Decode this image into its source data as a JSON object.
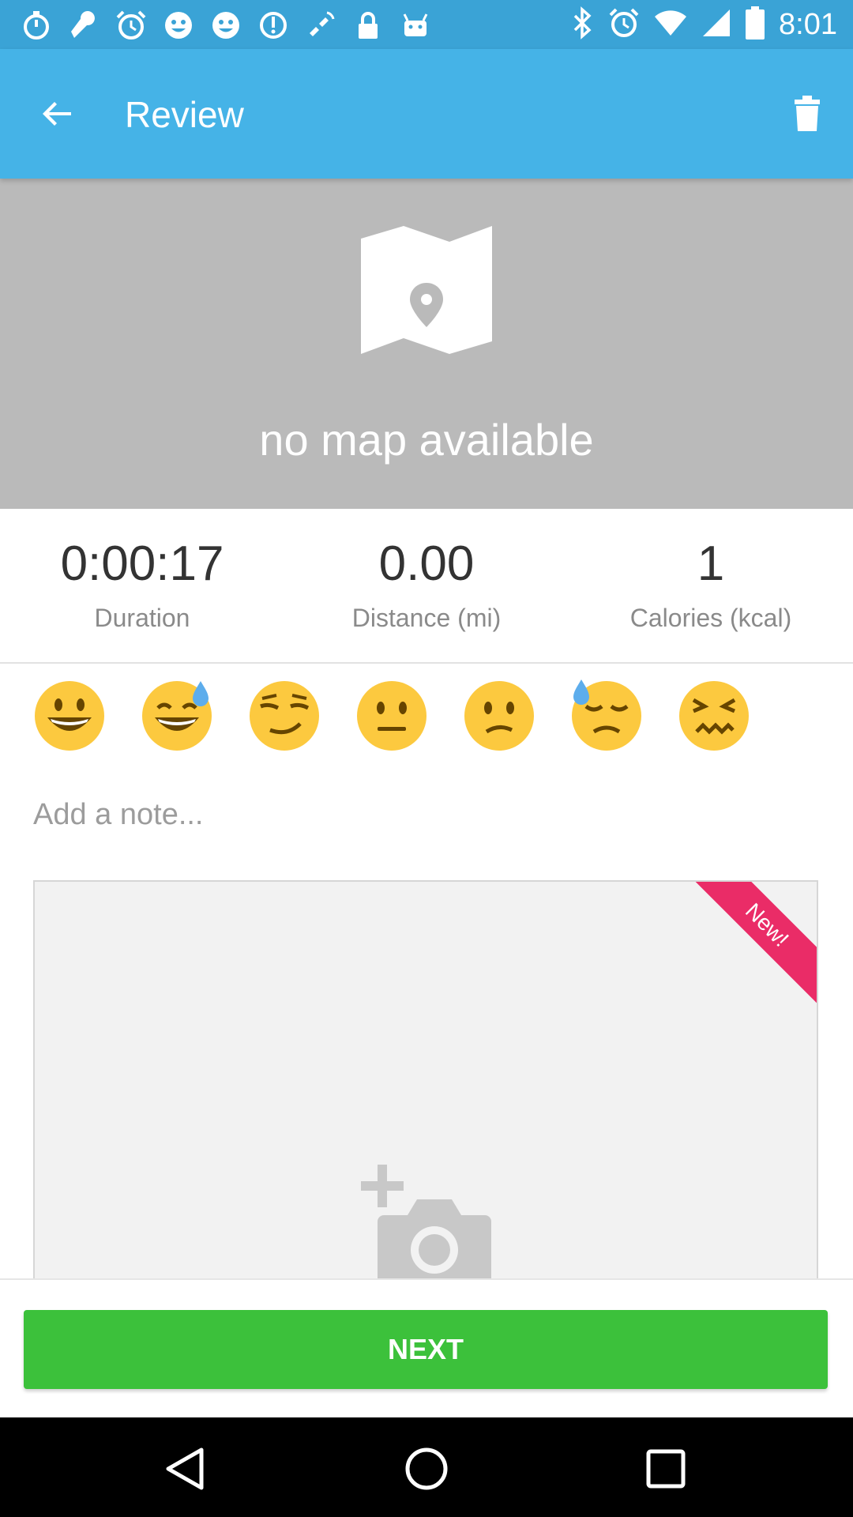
{
  "status_bar": {
    "time": "8:01",
    "left_icons": [
      "stopwatch-icon",
      "wrench-icon",
      "alarm-icon",
      "smiley-icon",
      "smiley-icon",
      "speed-icon",
      "fake-gps-icon",
      "lock-icon",
      "android-icon"
    ],
    "right_icons": [
      "bluetooth-icon",
      "alarm-icon",
      "wifi-icon",
      "signal-icon",
      "battery-icon"
    ]
  },
  "toolbar": {
    "title": "Review",
    "back_icon": "arrow-back-icon",
    "delete_icon": "trash-icon"
  },
  "map": {
    "message": "no map available",
    "icon": "map-pin-icon"
  },
  "stats": [
    {
      "value": "0:00:17",
      "label": "Duration"
    },
    {
      "value": "0.00",
      "label": "Distance (mi)"
    },
    {
      "value": "1",
      "label": "Calories (kcal)"
    }
  ],
  "moods": [
    "grinning-face",
    "grinning-sweat-face",
    "smirking-face",
    "neutral-face",
    "confused-face",
    "downcast-sweat-face",
    "confounded-face"
  ],
  "note": {
    "placeholder": "Add a note..."
  },
  "photo": {
    "badge": "New!",
    "icon": "add-photo-icon"
  },
  "next_label": "NEXT",
  "colors": {
    "toolbar": "#45b3e7",
    "status_bar": "#3aa3d6",
    "map_bg": "#bababa",
    "accent_green": "#3cc13b",
    "badge_pink": "#ea2c67"
  },
  "nav": [
    "back-icon",
    "home-icon",
    "recents-icon"
  ]
}
